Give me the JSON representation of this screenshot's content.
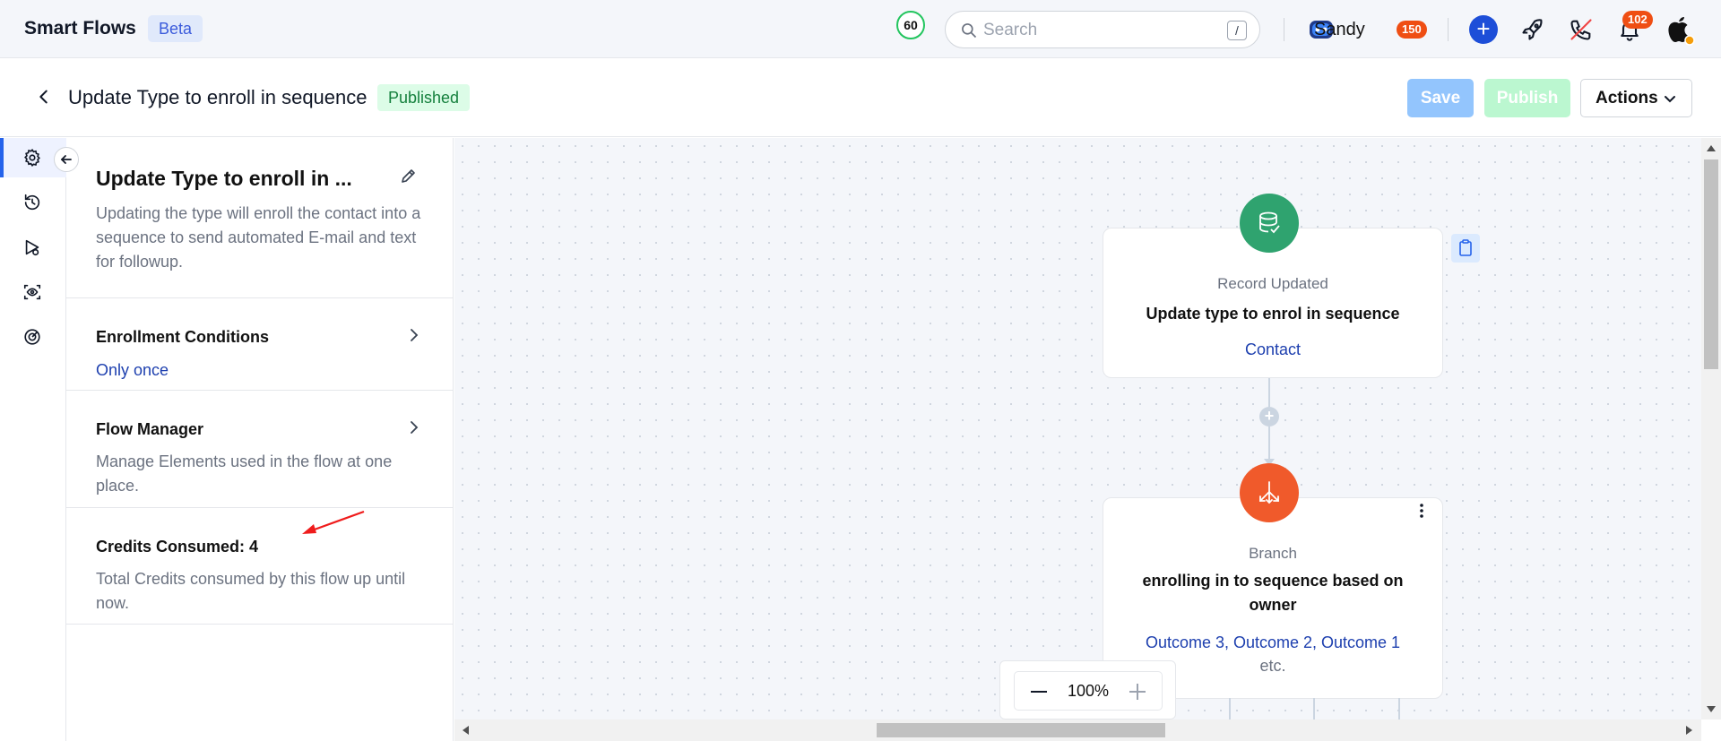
{
  "topbar": {
    "brand": "Smart Flows",
    "beta_label": "Beta",
    "credits_circle": "60",
    "search_placeholder": "Search",
    "search_shortcut": "/",
    "user_name": "Sandy",
    "user_badge": "150",
    "notifications_badge": "102"
  },
  "header": {
    "title": "Update Type to enroll in sequence",
    "status": "Published",
    "save_label": "Save",
    "publish_label": "Publish",
    "actions_label": "Actions"
  },
  "rail": {
    "items": [
      "gear-icon",
      "history-icon",
      "test-run-icon",
      "preview-icon",
      "goal-icon"
    ]
  },
  "panel": {
    "title": "Update Type to enroll in ...",
    "description": "Updating the type will enroll the contact into a sequence to send automated E-mail and text for followup.",
    "enrollment": {
      "title": "Enrollment Conditions",
      "value": "Only once"
    },
    "flow_manager": {
      "title": "Flow Manager",
      "description": "Manage Elements used in the flow at one place."
    },
    "credits": {
      "title": "Credits Consumed: 4",
      "description": "Total Credits consumed by this flow up until now."
    }
  },
  "canvas": {
    "trigger": {
      "type": "Record Updated",
      "name": "Update type to enrol in sequence",
      "link": "Contact"
    },
    "branch": {
      "type": "Branch",
      "name": "enrolling in to sequence based on owner",
      "link": "Outcome 3, Outcome 2, Outcome 1",
      "etc": "etc."
    },
    "zoom": "100%"
  },
  "colors": {
    "accent": "#1d4ed8",
    "trigger_green": "#2fa36f",
    "branch_orange": "#f05a2b",
    "badge_orange": "#ef4e13"
  }
}
